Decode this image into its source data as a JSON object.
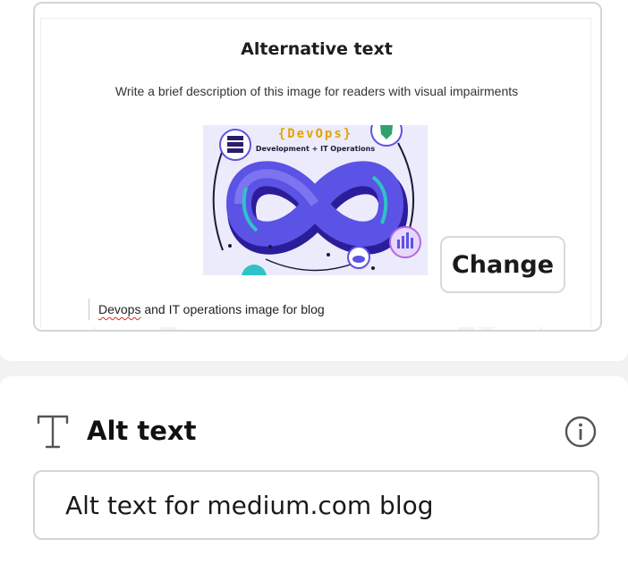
{
  "preview": {
    "title": "Alternative text",
    "subtitle": "Write a brief description of this image for readers with visual impairments",
    "caption_word": "Devops",
    "caption_rest": " and IT operations image for blog",
    "thumbnail": {
      "brand": "{DevOps}",
      "tagline": "Development + IT Operations",
      "icons": [
        "server-icon",
        "shield-icon",
        "chart-icon",
        "cloud-icon",
        "gear-icon"
      ]
    },
    "change_label": "Change"
  },
  "alt_section": {
    "title": "Alt text",
    "icon": "text-t-icon",
    "info_icon": "info-icon",
    "input_value": "Alt text for medium.com blog"
  },
  "colors": {
    "accent_purple": "#5b52e6",
    "brand_yellow": "#e5a300",
    "teal": "#2fc3c5",
    "border": "#d5d5d5"
  }
}
